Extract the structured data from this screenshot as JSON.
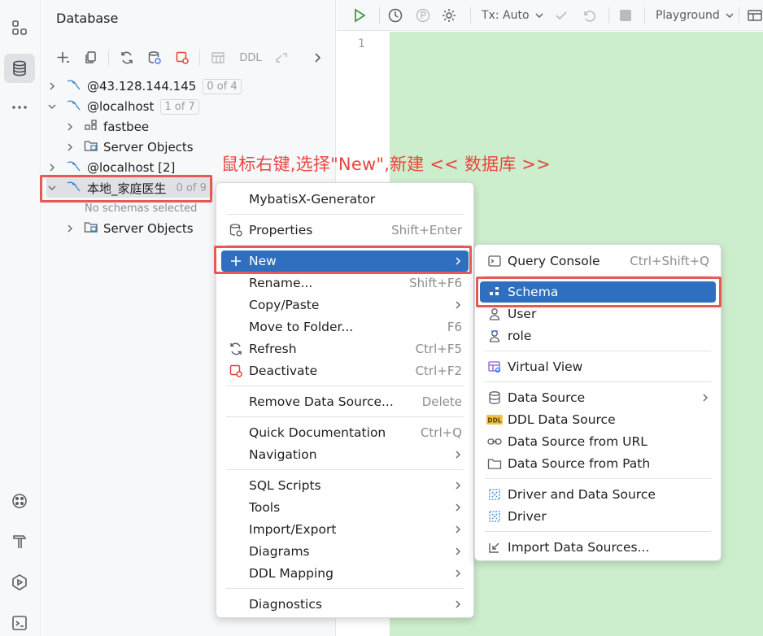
{
  "panel": {
    "title": "Database",
    "toolbar": {
      "ddl_label": "DDL"
    }
  },
  "tree": [
    {
      "label": "@43.128.144.145",
      "badge": "0 of 4"
    },
    {
      "label": "@localhost",
      "badge": "1 of 7"
    },
    {
      "label": "fastbee"
    },
    {
      "label": "Server Objects"
    },
    {
      "label": "@localhost [2]"
    },
    {
      "label": "本地_家庭医生",
      "badge": "0 of 9"
    },
    {
      "note": "No schemas selected"
    },
    {
      "label": "Server Objects"
    }
  ],
  "editor": {
    "tx_label": "Tx: Auto",
    "playground_label": "Playground",
    "line_number": "1",
    "background": "#cdeecd"
  },
  "annotation": {
    "text": "鼠标右键,选择\"New\",新建 << 数据库 >>",
    "color": "#e8463f"
  },
  "context_menu": {
    "items": [
      {
        "label": "MybatisX-Generator"
      },
      {
        "label": "Properties",
        "shortcut": "Shift+Enter",
        "icon": "properties-icon"
      },
      {
        "label": "New",
        "icon": "plus-icon",
        "highlighted": true
      },
      {
        "label": "Rename...",
        "shortcut": "Shift+F6"
      },
      {
        "label": "Copy/Paste"
      },
      {
        "label": "Move to Folder...",
        "shortcut": "F6"
      },
      {
        "label": "Refresh",
        "shortcut": "Ctrl+F5",
        "icon": "refresh-icon"
      },
      {
        "label": "Deactivate",
        "shortcut": "Ctrl+F2",
        "icon": "deactivate-icon"
      },
      {
        "label": "Remove Data Source...",
        "shortcut": "Delete"
      },
      {
        "label": "Quick Documentation",
        "shortcut": "Ctrl+Q"
      },
      {
        "label": "Navigation"
      },
      {
        "label": "SQL Scripts"
      },
      {
        "label": "Tools"
      },
      {
        "label": "Import/Export"
      },
      {
        "label": "Diagrams"
      },
      {
        "label": "DDL Mapping"
      },
      {
        "label": "Diagnostics"
      }
    ]
  },
  "submenu": {
    "items": [
      {
        "label": "Query Console",
        "shortcut": "Ctrl+Shift+Q",
        "icon": "console-icon"
      },
      {
        "label": "Schema",
        "icon": "schema-icon",
        "highlighted": true
      },
      {
        "label": "User",
        "icon": "user-icon"
      },
      {
        "label": "role",
        "icon": "role-icon"
      },
      {
        "label": "Virtual View",
        "icon": "virtual-view-icon"
      },
      {
        "label": "Data Source",
        "icon": "database-icon"
      },
      {
        "label": "DDL Data Source",
        "icon": "ddl-icon"
      },
      {
        "label": "Data Source from URL",
        "icon": "url-icon"
      },
      {
        "label": "Data Source from Path",
        "icon": "folder-icon"
      },
      {
        "label": "Driver and Data Source",
        "icon": "driver-datasource-icon"
      },
      {
        "label": "Driver",
        "icon": "driver-icon"
      },
      {
        "label": "Import Data Sources...",
        "icon": "import-icon"
      }
    ]
  },
  "colors": {
    "highlight": "#2f6fc0",
    "annotation_box": "#e65a55"
  }
}
